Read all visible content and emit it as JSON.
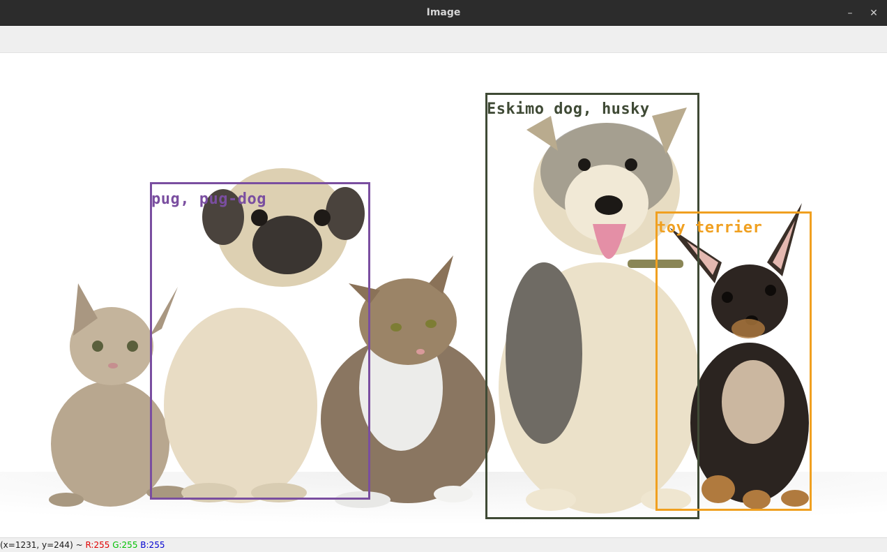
{
  "window": {
    "title": "Image",
    "minimize_label": "–",
    "close_label": "✕"
  },
  "detections": [
    {
      "label": "pug, pug-dog",
      "color": "#7a4ea0"
    },
    {
      "label": "Eskimo dog, husky",
      "color": "#3f4a35"
    },
    {
      "label": "toy terrier",
      "color": "#f0a020"
    }
  ],
  "status": {
    "coords": "(x=1231, y=244) ~",
    "r": "R:255",
    "g": "G:255",
    "b": "B:255"
  }
}
